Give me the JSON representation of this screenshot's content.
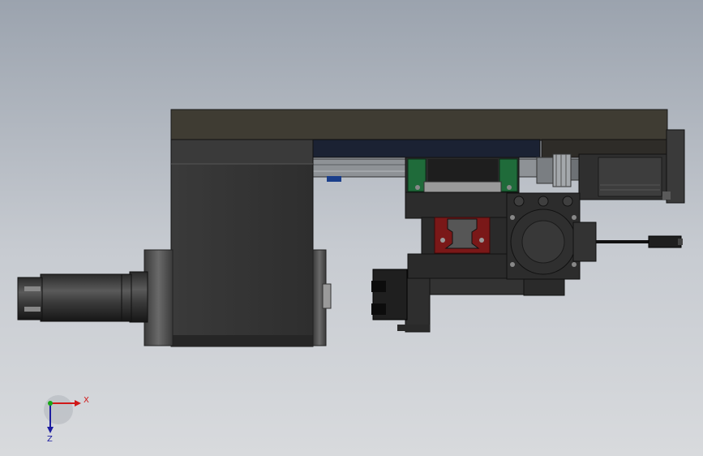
{
  "viewport": {
    "background_top": "#9ba3ae",
    "background_bottom": "#d8dadd"
  },
  "model": {
    "colors": {
      "body_dark": "#2c2c2c",
      "plate": "#3f3c33",
      "rail_blue": "#1b2233",
      "guide_green": "#1f6b3a",
      "block_red": "#7a1818",
      "cable": "#111111"
    }
  },
  "triad": {
    "x_label": "X",
    "z_label": "Z",
    "x_color": "#d01818",
    "y_color": "#18a818",
    "z_color": "#1c1ca0"
  }
}
